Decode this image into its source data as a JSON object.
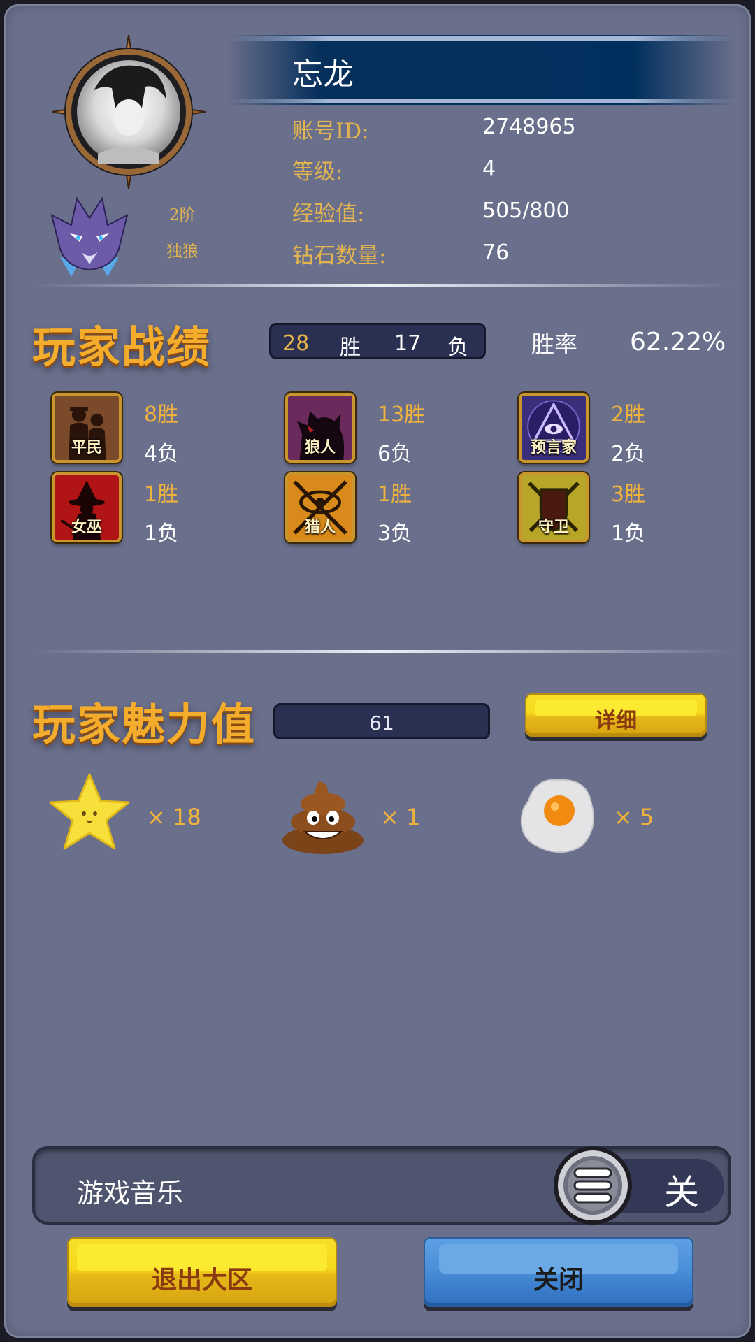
{
  "profile": {
    "name": "忘龙",
    "account_id_label": "账号ID:",
    "account_id": "2748965",
    "level_label": "等级:",
    "level": "4",
    "exp_label": "经验值:",
    "exp": "505/800",
    "diamond_label": "钻石数量:",
    "diamonds": "76",
    "rank_tier": "2阶",
    "rank_name": "独狼"
  },
  "record": {
    "title": "玩家战绩",
    "wins": "28",
    "win_label": "胜",
    "losses": "17",
    "loss_label": "负",
    "winrate_label": "胜率",
    "winrate": "62.22%",
    "roles": [
      {
        "name": "平民",
        "wins": "8胜",
        "losses": "4负",
        "icon": "villager-icon"
      },
      {
        "name": "狼人",
        "wins": "13胜",
        "losses": "6负",
        "icon": "werewolf-icon"
      },
      {
        "name": "预言家",
        "wins": "2胜",
        "losses": "2负",
        "icon": "seer-icon"
      },
      {
        "name": "女巫",
        "wins": "1胜",
        "losses": "1负",
        "icon": "witch-icon"
      },
      {
        "name": "猎人",
        "wins": "1胜",
        "losses": "3负",
        "icon": "hunter-icon"
      },
      {
        "name": "守卫",
        "wins": "3胜",
        "losses": "1负",
        "icon": "guard-icon"
      }
    ]
  },
  "charm": {
    "title": "玩家魅力值",
    "value": "61",
    "detail_label": "详细",
    "gifts": [
      {
        "icon": "star-icon",
        "count": "× 18"
      },
      {
        "icon": "poop-icon",
        "count": "× 1"
      },
      {
        "icon": "egg-icon",
        "count": "× 5"
      }
    ]
  },
  "settings": {
    "music_label": "游戏音乐",
    "music_state": "关"
  },
  "buttons": {
    "exit_label": "退出大区",
    "close_label": "关闭"
  },
  "colors": {
    "panel": "#6a6f8b",
    "accent_gold": "#f0b23e",
    "banner_blue": "#02305e",
    "button_yellow": "#f6d91c",
    "button_blue": "#4a8fd8"
  }
}
